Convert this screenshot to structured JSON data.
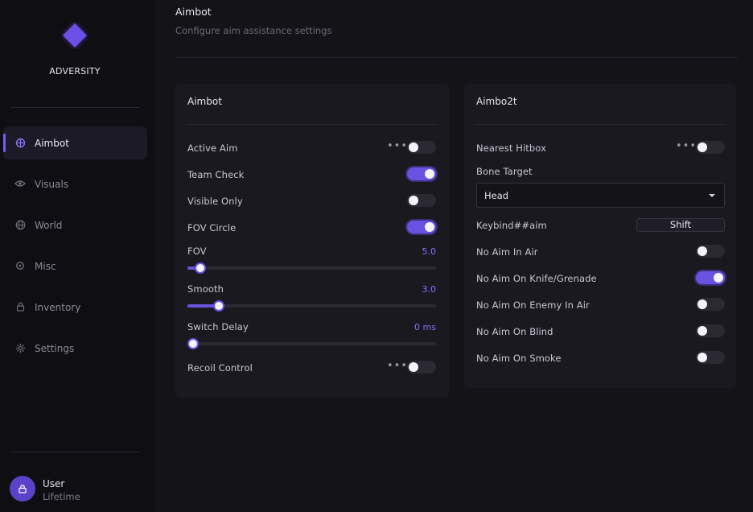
{
  "app": {
    "brand": "ADVERSITY",
    "accent": "#6a51e0"
  },
  "sidebar": {
    "items": [
      {
        "label": "Aimbot",
        "icon": "crosshair-icon",
        "active": true
      },
      {
        "label": "Visuals",
        "icon": "eye-icon",
        "active": false
      },
      {
        "label": "World",
        "icon": "globe-icon",
        "active": false
      },
      {
        "label": "Misc",
        "icon": "misc-icon",
        "active": false
      },
      {
        "label": "Inventory",
        "icon": "lock-icon",
        "active": false
      },
      {
        "label": "Settings",
        "icon": "gear-icon",
        "active": false
      }
    ]
  },
  "user": {
    "name": "User",
    "plan": "Lifetime",
    "icon": "lock-icon"
  },
  "header": {
    "title": "Aimbot",
    "subtitle": "Configure aim assistance settings"
  },
  "panel_left": {
    "title": "Aimbot",
    "active_aim": {
      "label": "Active Aim",
      "on": false
    },
    "team_check": {
      "label": "Team Check",
      "on": true
    },
    "visible_only": {
      "label": "Visible Only",
      "on": false
    },
    "fov_circle": {
      "label": "FOV Circle",
      "on": true
    },
    "fov": {
      "label": "FOV",
      "value": "5.0",
      "fraction": 0.03
    },
    "smooth": {
      "label": "Smooth",
      "value": "3.0",
      "fraction": 0.11
    },
    "switch_delay": {
      "label": "Switch Delay",
      "value": "0 ms",
      "fraction": 0.0
    },
    "recoil_control": {
      "label": "Recoil Control",
      "on": false
    },
    "more_icon": "•••"
  },
  "panel_right": {
    "title": "Aimbo2t",
    "nearest_hitbox": {
      "label": "Nearest Hitbox",
      "on": false
    },
    "bone_target": {
      "label": "Bone Target",
      "value": "Head"
    },
    "keybind": {
      "label": "Keybind##aim",
      "value": "Shift"
    },
    "no_aim_in_air": {
      "label": "No Aim In Air",
      "on": false
    },
    "no_aim_knife": {
      "label": "No Aim On Knife/Grenade",
      "on": true
    },
    "no_aim_enemy_air": {
      "label": "No Aim On Enemy In Air",
      "on": false
    },
    "no_aim_blind": {
      "label": "No Aim On Blind",
      "on": false
    },
    "no_aim_smoke": {
      "label": "No Aim On Smoke",
      "on": false
    },
    "more_icon": "•••"
  }
}
